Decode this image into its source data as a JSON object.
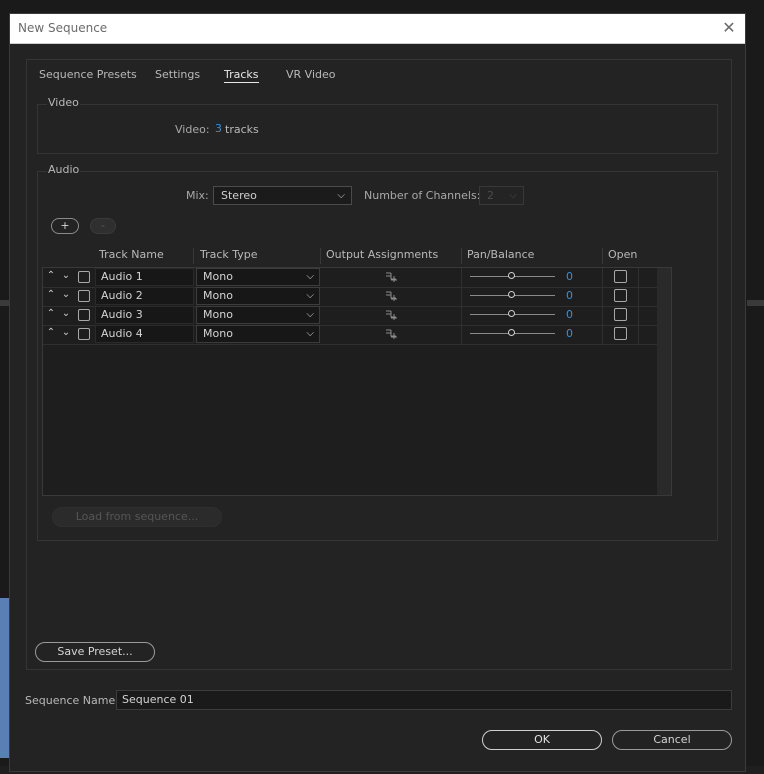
{
  "window": {
    "title": "New Sequence"
  },
  "tabs": [
    {
      "label": "Sequence Presets"
    },
    {
      "label": "Settings"
    },
    {
      "label": "Tracks",
      "active": true
    },
    {
      "label": "VR Video"
    }
  ],
  "video": {
    "group_label": "Video",
    "label": "Video:",
    "track_count": "3",
    "tracks_word": "tracks"
  },
  "audio": {
    "group_label": "Audio",
    "mix_label": "Mix:",
    "mix_value": "Stereo",
    "channels_label": "Number of Channels:",
    "channels_value": "2",
    "add_label": "+",
    "remove_label": "-",
    "columns": [
      "Track Name",
      "Track Type",
      "Output Assignments",
      "Pan/Balance",
      "Open"
    ],
    "tracks": [
      {
        "name": "Audio 1",
        "type": "Mono",
        "pan": "0",
        "open": false
      },
      {
        "name": "Audio 2",
        "type": "Mono",
        "pan": "0",
        "open": false
      },
      {
        "name": "Audio 3",
        "type": "Mono",
        "pan": "0",
        "open": false
      },
      {
        "name": "Audio 4",
        "type": "Mono",
        "pan": "0",
        "open": false
      }
    ],
    "load_button": "Load from sequence..."
  },
  "footer": {
    "save_preset": "Save Preset...",
    "sequence_name_label": "Sequence Name:",
    "sequence_name_value": "Sequence 01",
    "ok": "OK",
    "cancel": "Cancel"
  },
  "colors": {
    "accent": "#3a8fd6",
    "background": "#232323",
    "titlebar": "#ffffff"
  },
  "icons": {
    "close": "close-icon",
    "move_up": "chevron-up-icon",
    "move_down": "chevron-down-icon",
    "output": "output-routing-icon",
    "dropdown": "chevron-down-icon"
  }
}
